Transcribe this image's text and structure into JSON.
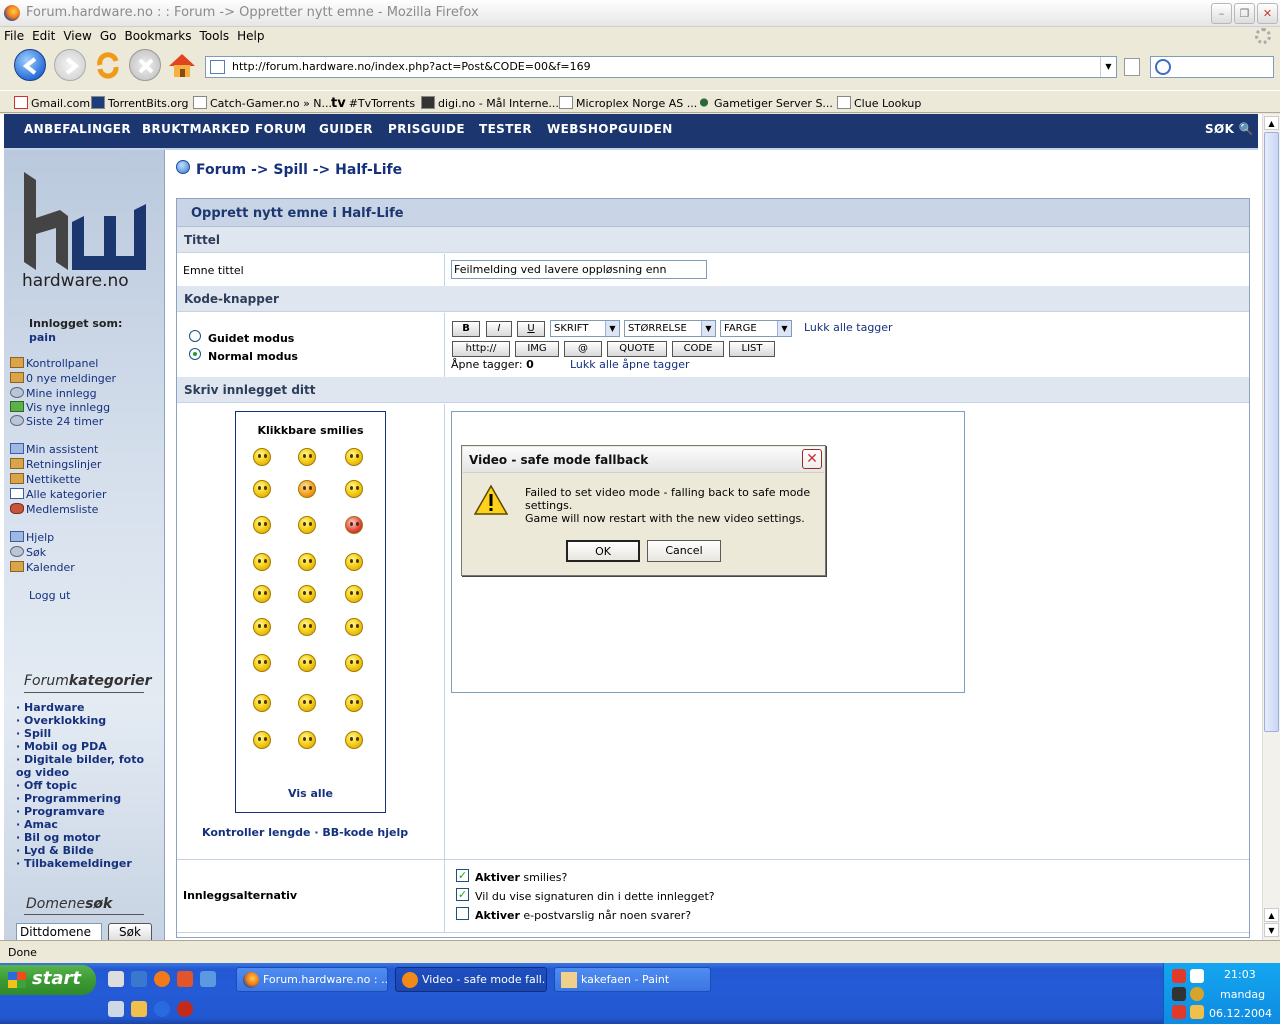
{
  "window": {
    "title": "Forum.hardware.no : : Forum -> Oppretter nytt emne - Mozilla Firefox"
  },
  "menu": [
    "File",
    "Edit",
    "View",
    "Go",
    "Bookmarks",
    "Tools",
    "Help"
  ],
  "toolbar": {
    "url": "http://forum.hardware.no/index.php?act=Post&CODE=00&f=169"
  },
  "bookmarks": [
    "Gmail.com",
    "TorrentBits.org",
    "Catch-Gamer.no » N...",
    "#TvTorrents",
    "digi.no - Mål Interne...",
    "Microplex Norge AS ...",
    "Gametiger Server S...",
    "Clue Lookup"
  ],
  "sitenav": {
    "items": [
      "ANBEFALINGER",
      "BRUKTMARKED",
      "FORUM",
      "GUIDER",
      "PRISGUIDE",
      "TESTER",
      "WEBSHOPGUIDEN"
    ],
    "search": "SØK"
  },
  "sidebar": {
    "logo_text": "hardware.no",
    "logged_in_label": "Innlogget som:",
    "username": "pain",
    "links1": [
      "Kontrollpanel",
      "0 nye meldinger",
      "Mine innlegg",
      "Vis nye innlegg",
      "Siste 24 timer"
    ],
    "links2": [
      "Min assistent",
      "Retningslinjer",
      "Nettikette",
      "Alle kategorier",
      "Medlemsliste"
    ],
    "links3": [
      "Hjelp",
      "Søk",
      "Kalender"
    ],
    "logout": "Logg ut",
    "cat_title_a": "Forum",
    "cat_title_b": "kategorier",
    "categories": [
      "Hardware",
      "Overklokking",
      "Spill",
      "Mobil og PDA",
      "Digitale bilder, foto",
      "og video",
      "Off topic",
      "Programmering",
      "Programvare",
      "Amac",
      "Bil og motor",
      "Lyd & Bilde",
      "Tilbakemeldinger"
    ],
    "domain_title_a": "Domene",
    "domain_title_b": "søk",
    "domain_value": "Dittdomene",
    "domain_button": "Søk"
  },
  "breadcrumb": "Forum -> Spill -> Half-Life",
  "form": {
    "title": "Opprett nytt emne i Half-Life",
    "sec_title": "Tittel",
    "topic_label": "Emne tittel",
    "topic_value": "Feilmelding ved lavere oppløsning enn",
    "sec_code": "Kode-knapper",
    "mode_guided": "Guidet modus",
    "mode_normal": "Normal modus",
    "btn_b": "B",
    "btn_i": "I",
    "btn_u": "U",
    "sel_font": "SKRIFT",
    "sel_size": "STØRRELSE",
    "sel_color": "FARGE",
    "close_all": "Lukk alle tagger",
    "btn_http": "http://",
    "btn_img": "IMG",
    "btn_at": "@",
    "btn_quote": "QUOTE",
    "btn_code": "CODE",
    "btn_list": "LIST",
    "open_tags_label": "Åpne tagger:",
    "open_tags_count": "0",
    "close_open": "Lukk alle åpne tagger",
    "sec_write": "Skriv innlegget ditt",
    "smilies_title": "Klikkbare smilies",
    "show_all": "Vis alle",
    "check_length": "Kontroller lengde",
    "bb_help": "BB-kode hjelp",
    "options_label": "Innleggsalternativ",
    "opt1_bold": "Aktiver",
    "opt1_rest": " smilies?",
    "opt2": "Vil du vise signaturen din i dette innlegget?",
    "opt3_bold": "Aktiver",
    "opt3_rest": " e-postvarslig når noen svarer?"
  },
  "dialog": {
    "title": "Video - safe mode fallback",
    "line1": "Failed to set video mode - falling back to safe mode settings.",
    "line2": "Game will now restart with the new video settings.",
    "ok": "OK",
    "cancel": "Cancel"
  },
  "status": {
    "text": "Done"
  },
  "taskbar": {
    "start": "start",
    "tasks": [
      "Forum.hardware.no : ...",
      "Video - safe mode fall...",
      "kakefaen - Paint"
    ],
    "time": "21:03",
    "day": "mandag",
    "date": "06.12.2004"
  }
}
